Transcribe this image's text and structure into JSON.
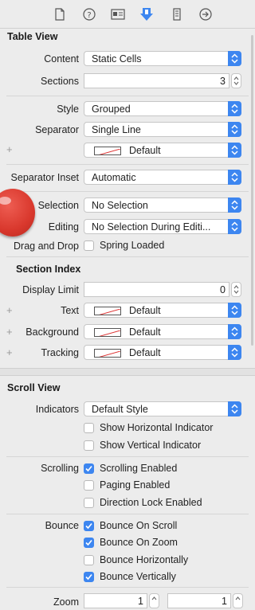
{
  "colors": {
    "accent": "#3d86f0",
    "marker": "#d9382d"
  },
  "toolbar": {
    "icons": [
      "file-icon",
      "help-icon",
      "identity-icon",
      "attributes-icon",
      "size-icon",
      "connections-icon"
    ]
  },
  "table_view": {
    "title": "Table View",
    "content_label": "Content",
    "content_value": "Static Cells",
    "sections_label": "Sections",
    "sections_value": "3",
    "style_label": "Style",
    "style_value": "Grouped",
    "separator_label": "Separator",
    "separator_value": "Single Line",
    "separator_color_value": "Default",
    "separator_inset_label": "Separator Inset",
    "separator_inset_value": "Automatic",
    "selection_label": "Selection",
    "selection_value": "No Selection",
    "editing_label": "Editing",
    "editing_value": "No Selection During Editi...",
    "drag_drop_label": "Drag and Drop",
    "spring_loaded_label": "Spring Loaded"
  },
  "section_index": {
    "title": "Section Index",
    "display_limit_label": "Display Limit",
    "display_limit_value": "0",
    "text_label": "Text",
    "text_value": "Default",
    "background_label": "Background",
    "background_value": "Default",
    "tracking_label": "Tracking",
    "tracking_value": "Default"
  },
  "scroll_view": {
    "title": "Scroll View",
    "indicators_label": "Indicators",
    "indicators_value": "Default Style",
    "show_horizontal": "Show Horizontal Indicator",
    "show_horizontal_checked": false,
    "show_vertical": "Show Vertical Indicator",
    "show_vertical_checked": false,
    "scrolling_label": "Scrolling",
    "scrolling_enabled": "Scrolling Enabled",
    "scrolling_enabled_checked": true,
    "paging_enabled": "Paging Enabled",
    "paging_enabled_checked": false,
    "direction_lock": "Direction Lock Enabled",
    "direction_lock_checked": false,
    "bounce_label": "Bounce",
    "bounce_on_scroll": "Bounce On Scroll",
    "bounce_on_scroll_checked": true,
    "bounce_on_zoom": "Bounce On Zoom",
    "bounce_on_zoom_checked": true,
    "bounce_horizontally": "Bounce Horizontally",
    "bounce_horizontally_checked": false,
    "bounce_vertically": "Bounce Vertically",
    "bounce_vertically_checked": true,
    "zoom_label": "Zoom",
    "zoom_min": "1",
    "zoom_max": "1"
  }
}
